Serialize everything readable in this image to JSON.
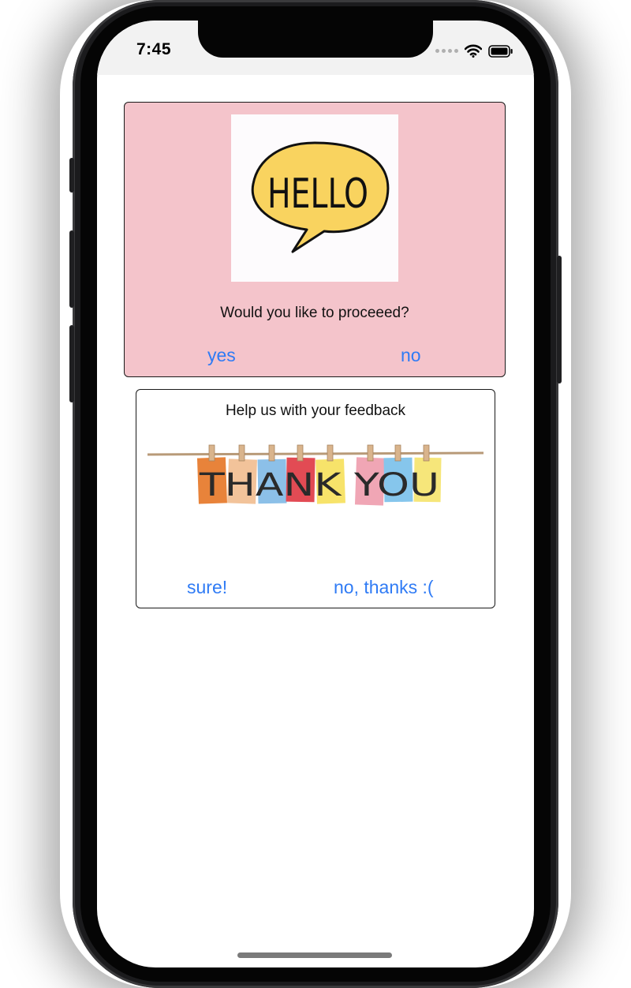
{
  "status_bar": {
    "time": "7:45"
  },
  "card1": {
    "question": "Would you like to proceeed?",
    "yes_label": "yes",
    "no_label": "no",
    "image_text": "HELLO",
    "background": "#f4c4cb"
  },
  "card2": {
    "title": "Help us with your feedback",
    "image_text": "THANK YOU",
    "sure_label": "sure!",
    "decline_label": "no, thanks :("
  },
  "colors": {
    "link": "#2f7bf5"
  }
}
